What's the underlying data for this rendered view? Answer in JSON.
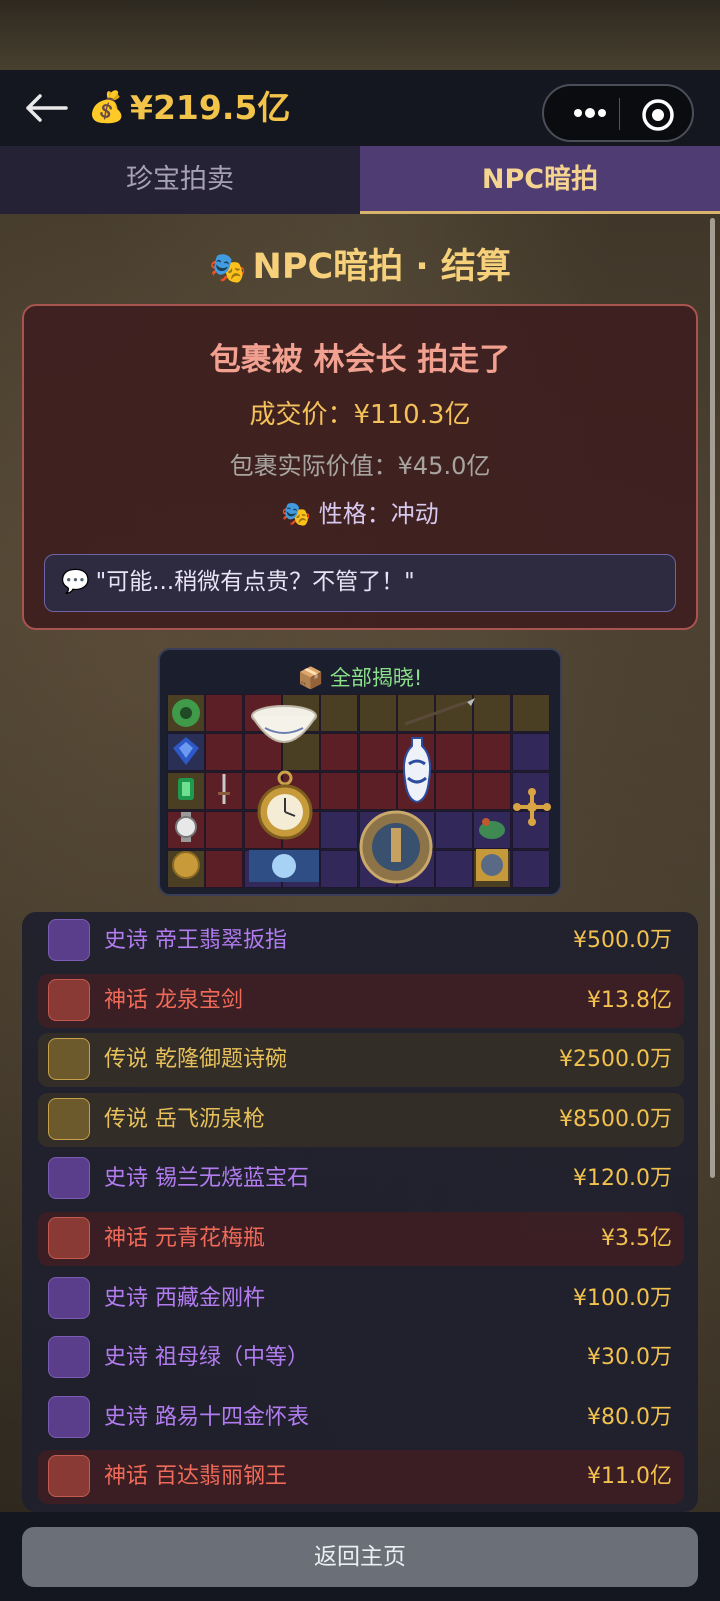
{
  "header": {
    "balance": "¥219.5亿"
  },
  "tabs": [
    {
      "label": "珍宝拍卖",
      "active": false
    },
    {
      "label": "NPC暗拍",
      "active": true
    }
  ],
  "settlement": {
    "title": "NPC暗拍 · 结算",
    "headline": "包裹被 林会长 拍走了",
    "deal_price": "成交价：¥110.3亿",
    "actual_value": "包裹实际价值：¥45.0亿",
    "personality": "性格：冲动",
    "quote": "\"可能...稍微有点贵？不管了！\""
  },
  "reveal": {
    "title": "全部揭晓!"
  },
  "items": [
    {
      "quality": "史诗",
      "name": "帝王翡翠扳指",
      "price": "¥500.0万",
      "tier": "epic",
      "icon": "jade-ring-icon"
    },
    {
      "quality": "神话",
      "name": "龙泉宝剑",
      "price": "¥13.8亿",
      "tier": "myth",
      "icon": "sword-icon"
    },
    {
      "quality": "传说",
      "name": "乾隆御题诗碗",
      "price": "¥2500.0万",
      "tier": "legend",
      "icon": "porcelain-bowl-icon"
    },
    {
      "quality": "传说",
      "name": "岳飞沥泉枪",
      "price": "¥8500.0万",
      "tier": "legend",
      "icon": "spear-icon"
    },
    {
      "quality": "史诗",
      "name": "锡兰无烧蓝宝石",
      "price": "¥120.0万",
      "tier": "epic",
      "icon": "sapphire-icon"
    },
    {
      "quality": "神话",
      "name": "元青花梅瓶",
      "price": "¥3.5亿",
      "tier": "myth",
      "icon": "vase-icon"
    },
    {
      "quality": "史诗",
      "name": "西藏金刚杵",
      "price": "¥100.0万",
      "tier": "epic",
      "icon": "vajra-icon"
    },
    {
      "quality": "史诗",
      "name": "祖母绿（中等）",
      "price": "¥30.0万",
      "tier": "epic",
      "icon": "emerald-icon"
    },
    {
      "quality": "史诗",
      "name": "路易十四金怀表",
      "price": "¥80.0万",
      "tier": "epic",
      "icon": "pocket-watch-icon"
    },
    {
      "quality": "神话",
      "name": "百达翡丽钢王",
      "price": "¥11.0亿",
      "tier": "myth",
      "icon": "wristwatch-icon"
    }
  ],
  "footer": {
    "home_button": "返回主页"
  },
  "colors": {
    "gold": "#f3c44a",
    "epic": "#b27cf0",
    "myth": "#ef6a58",
    "legend": "#e7c05c",
    "active_tab": "#4e3c72"
  }
}
